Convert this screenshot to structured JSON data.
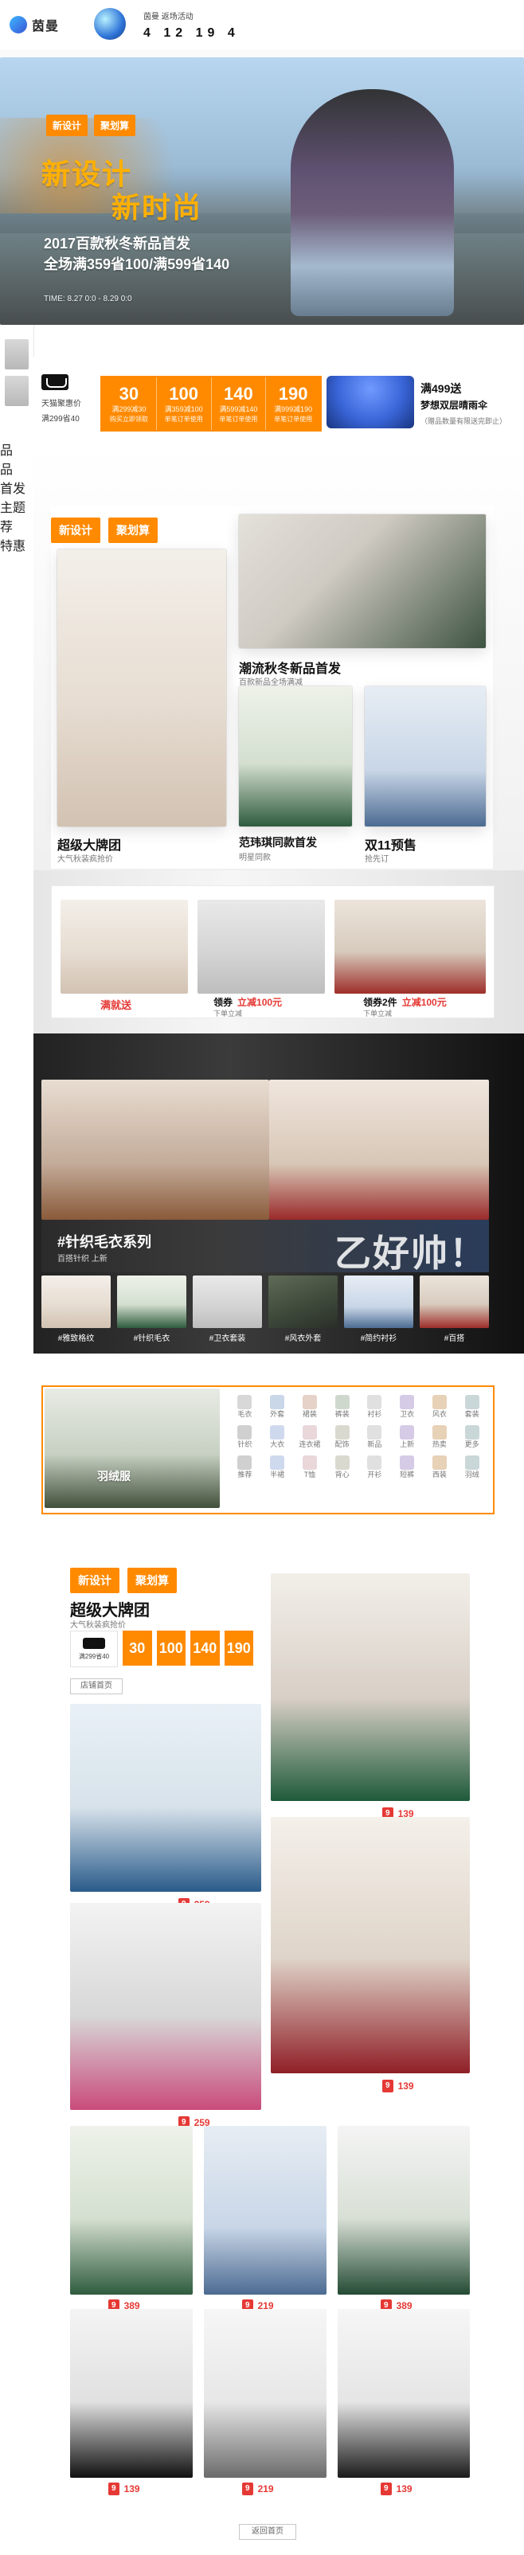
{
  "colors": {
    "accent": "#ff8a00",
    "red": "#e53935",
    "text": "#222222"
  },
  "topbar": {
    "brand": "茵曼",
    "promo_line1": "茵曼 返场活动",
    "promo_line2": "4 12 19 4"
  },
  "hero": {
    "logo_left": "新设计",
    "logo_right": "聚划算",
    "headline_1": "新设计",
    "headline_2": "新时尚",
    "subline_1": "2017百款秋冬新品首发",
    "subline_2": "全场满359省100/满599省140",
    "time": "TIME: 8.27 0:0 - 8.29 0:0"
  },
  "left_nav": {
    "items": [
      "品",
      "品",
      "首发",
      "主题",
      "荐",
      "特惠"
    ]
  },
  "coupons_strip": {
    "store_text": "天猫聚惠价",
    "store_sub": "满299省40",
    "coupons": [
      {
        "amount": "30",
        "line1": "满299减30",
        "line2": "购买立即领取"
      },
      {
        "amount": "100",
        "line1": "满359减100",
        "line2": "单笔订单使用"
      },
      {
        "amount": "140",
        "line1": "满599减140",
        "line2": "单笔订单使用"
      },
      {
        "amount": "190",
        "line1": "满999减190",
        "line2": "单笔订单使用"
      }
    ],
    "gift_title": "满499送",
    "gift_sub": "梦想双层晴雨伞",
    "gift_note": "（赠品数量有限送完即止）"
  },
  "section_1": {
    "header_left": "新设计",
    "header_right": "聚划算",
    "left_caption": "超级大牌团",
    "left_caption_sub": "大气秋装疯抢价",
    "top_right_title": "潮流秋冬新品首发",
    "top_right_sub": "百款新品全场满减",
    "bottom_mid_title": "范玮琪同款首发",
    "bottom_mid_sub": "明星同款",
    "bottom_right_title": "双11预售",
    "bottom_right_sub": "抢先订"
  },
  "section_2": {
    "badge": "满就送",
    "deal_1_title": "领券",
    "deal_1_tag": "立减100元",
    "deal_1_sub": "下单立减",
    "deal_2_title": "领券2件",
    "deal_2_tag": "立减100元",
    "deal_2_sub": "下单立减"
  },
  "section_3": {
    "banner_tag": "#针织毛衣系列",
    "banner_sub": "百搭针织 上新",
    "big_text": "乙好帅！",
    "thumbs": [
      "#雅致格纹",
      "#针织毛衣",
      "#卫衣套装",
      "#风衣外套",
      "#简约衬衫",
      "#百搭"
    ]
  },
  "section_4": {
    "left_label": "羽绒服",
    "grid_labels": [
      "毛衣",
      "外套",
      "裙装",
      "裤装",
      "衬衫",
      "卫衣",
      "风衣",
      "套装",
      "针织",
      "大衣",
      "连衣裙",
      "配饰",
      "新品",
      "上新",
      "热卖",
      "更多",
      "推荐",
      "半裙",
      "T恤",
      "背心",
      "开衫",
      "短裤",
      "西装",
      "羽绒"
    ]
  },
  "section_5": {
    "header_left": "新设计",
    "header_right": "聚划算",
    "title": "超级大牌团",
    "subtitle": "大气秋装疯抢价",
    "coupons": [
      "30",
      "100",
      "140",
      "190"
    ],
    "coupon_line": "满299省40",
    "button": "店铺首页",
    "product_prices": [
      "259",
      "139",
      "259",
      "139",
      "389",
      "219",
      "389",
      "139",
      "219",
      "139"
    ],
    "product_badges": [
      "9",
      "9",
      "9",
      "9",
      "9",
      "9",
      "9",
      "9",
      "9",
      "9"
    ]
  },
  "footer": {
    "button": "返回首页"
  }
}
